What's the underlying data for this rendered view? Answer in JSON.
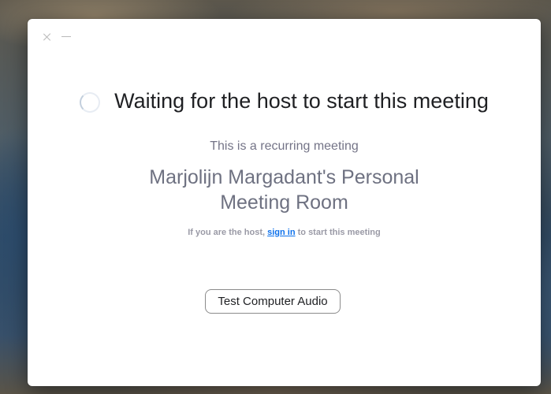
{
  "window": {
    "controls": {
      "close_icon": "close-icon",
      "minimize_icon": "minimize-icon"
    },
    "spinner_icon": "loading-spinner-icon",
    "title": "Waiting for the host to start this meeting",
    "recurring_text": "This is a recurring meeting",
    "room_name_line1": "Marjolijn Margadant's Personal",
    "room_name_line2": "Meeting Room",
    "host_note_prefix": "If you are the host,",
    "sign_in_link": "sign in",
    "host_note_suffix": "to start this meeting",
    "test_audio_button": "Test Computer Audio"
  },
  "colors": {
    "link": "#0e71eb",
    "title": "#1f2023",
    "secondary_text": "#747487"
  }
}
